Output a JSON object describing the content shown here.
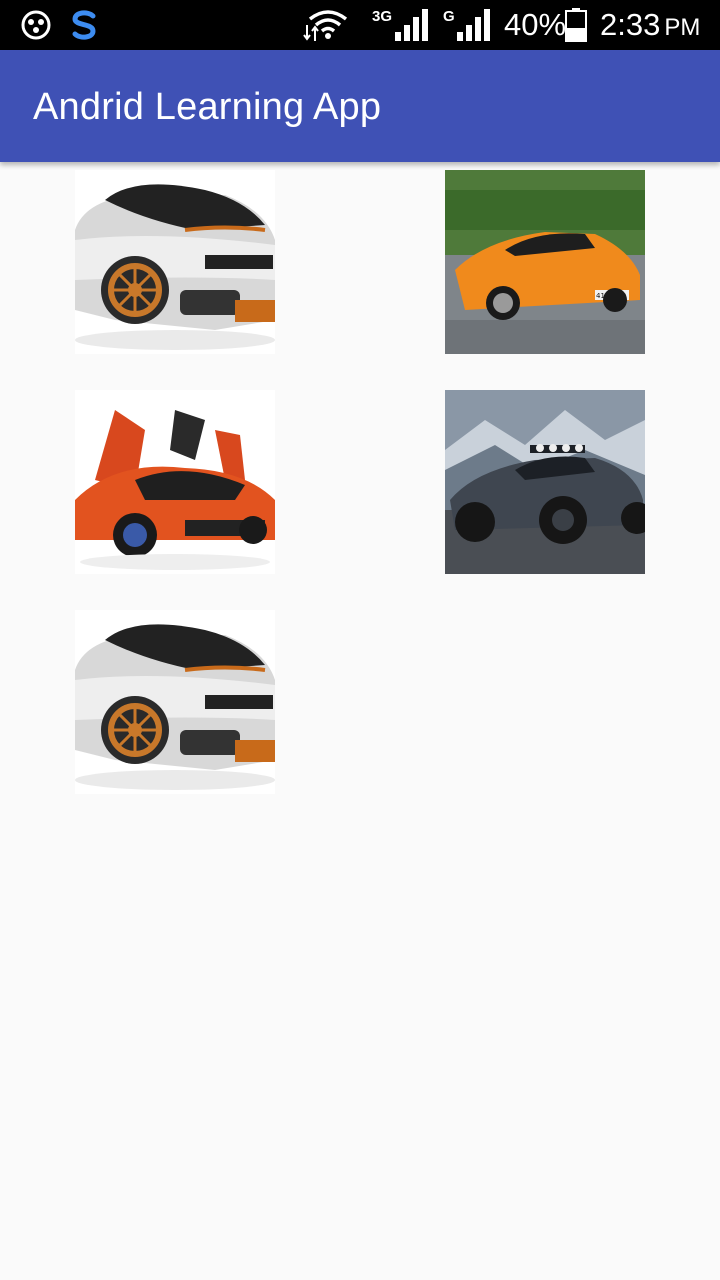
{
  "status_bar": {
    "left_icons": [
      "notification-app-icon",
      "s-logo-icon"
    ],
    "data_transfer_icon": "data-transfer-icon",
    "wifi_icon": "wifi-icon",
    "network_1_type": "3G",
    "network_2_type": "G",
    "battery_percent": "40%",
    "battery_icon": "battery-icon",
    "time": "2:33",
    "ampm": "PM"
  },
  "app_bar": {
    "title": "Andrid Learning App",
    "color": "#3f51b5"
  },
  "grid": {
    "columns": 2,
    "items": [
      {
        "subject": "white sports car with orange rims"
      },
      {
        "subject": "orange sports car on road",
        "plate_text": "415 KAD"
      },
      {
        "subject": "orange supercar with open doors"
      },
      {
        "subject": "grey off-road sports car in snowy mountains"
      },
      {
        "subject": "white sports car with orange rims"
      }
    ]
  }
}
